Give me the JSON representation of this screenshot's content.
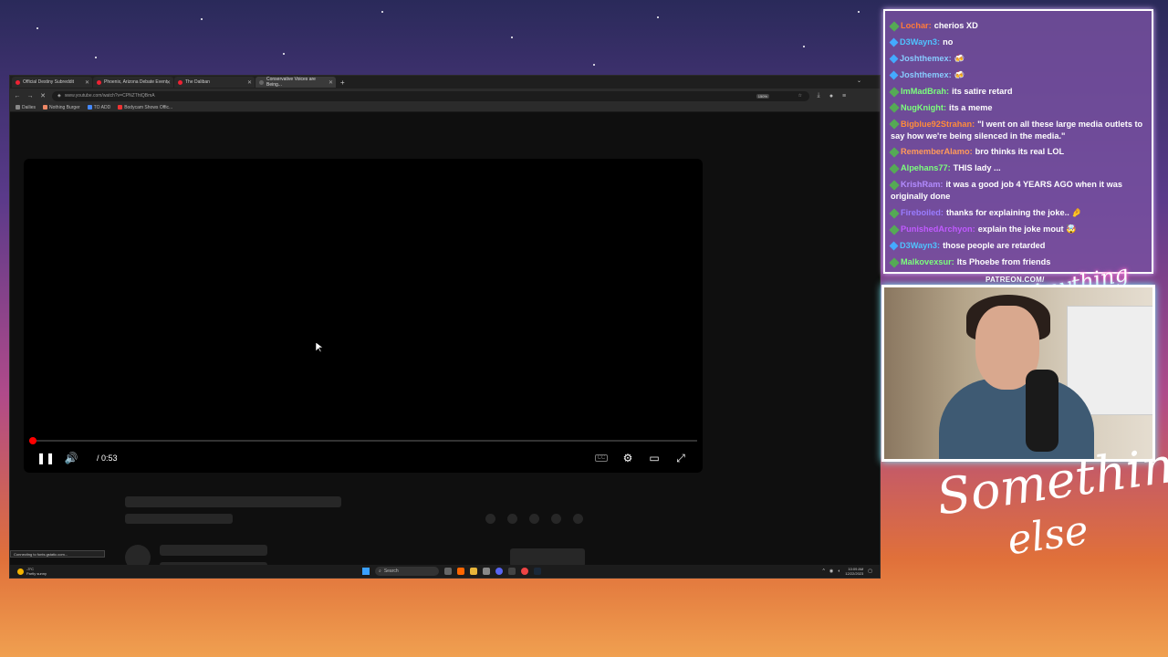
{
  "browser": {
    "tabs": [
      {
        "label": "Official Destiny Subreddit",
        "active": false
      },
      {
        "label": "Phoenix, Arizona Debate Event",
        "active": false
      },
      {
        "label": "The Daliban",
        "active": false
      },
      {
        "label": "Conservative Voices are Being...",
        "active": true
      }
    ],
    "url": "www.youtube.com/watch?v=CPNZThtQBmA",
    "zoom": "150%",
    "bookmarks": [
      "Dailies",
      "Nothing Burger",
      "TO ADD",
      "Bodycam Shows Offic..."
    ],
    "status_text": "Connecting to fonts.gstatic.com..."
  },
  "player": {
    "time": "/ 0:53",
    "progress_fraction": 0.0,
    "cc_label": "CC"
  },
  "taskbar": {
    "weather_temp": "-3°C",
    "weather_desc": "Partly sunny",
    "search_label": "Search",
    "clock_time": "10:09 AM",
    "clock_date": "12/22/2023"
  },
  "chat": {
    "messages": [
      {
        "user": "Lochar:",
        "text": "cherios XD",
        "user_color": "#ff7a3a"
      },
      {
        "user": "D3Wayn3:",
        "text": "no",
        "user_color": "#4fc3ff"
      },
      {
        "user": "Joshthemex:",
        "text": "🍻",
        "user_color": "#8cf"
      },
      {
        "user": "Joshthemex:",
        "text": "🍻",
        "user_color": "#8cf"
      },
      {
        "user": "ImMadBrah:",
        "text": "its satire retard",
        "user_color": "#7cff7c"
      },
      {
        "user": "NugKnight:",
        "text": "its a meme",
        "user_color": "#7cff7c"
      },
      {
        "user": "Bigblue92Strahan:",
        "text": "\"I went on all these large media outlets to say how we're being silenced in the media.\"",
        "user_color": "#ff8c3a"
      },
      {
        "user": "RememberAlamo:",
        "text": "bro thinks its real LOL",
        "user_color": "#ff9a5a"
      },
      {
        "user": "Alpehans77:",
        "text": "THIS lady ...",
        "user_color": "#7cff7c"
      },
      {
        "user": "KrishRam:",
        "text": "it was a good job 4 YEARS AGO when it was originally done",
        "user_color": "#b38cff"
      },
      {
        "user": "Fireboiled:",
        "text": "thanks for explaining the joke.. 🤌",
        "user_color": "#9a7cff"
      },
      {
        "user": "PunishedArchyon:",
        "text": "explain the joke mout 🤯",
        "user_color": "#c05aff"
      },
      {
        "user": "D3Wayn3:",
        "text": "those people are retarded",
        "user_color": "#4fc3ff"
      },
      {
        "user": "Malkovexsur:",
        "text": "Its Phoebe from friends",
        "user_color": "#7cff7c"
      }
    ]
  },
  "overlay": {
    "patreon": "PATREON.COM/",
    "logo_small": "Anything else",
    "logo_big_1": "Something",
    "logo_big_2": "else"
  },
  "icons": {
    "pause": "pause-icon",
    "volume": "volume-icon",
    "settings": "gear-icon",
    "theater": "theater-icon",
    "fullscreen": "fullscreen-icon"
  }
}
